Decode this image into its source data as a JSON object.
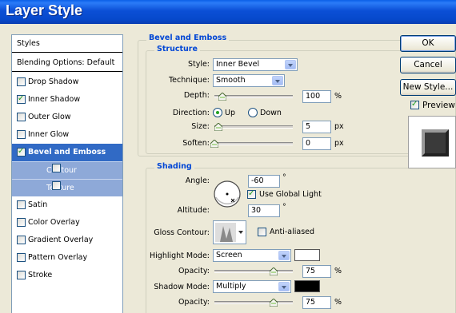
{
  "window": {
    "title": "Layer Style"
  },
  "styles_list": {
    "header": "Styles",
    "blending": "Blending Options: Default",
    "items": [
      {
        "label": "Drop Shadow",
        "checked": false,
        "kind": "row"
      },
      {
        "label": "Inner Shadow",
        "checked": true,
        "kind": "row"
      },
      {
        "label": "Outer Glow",
        "checked": false,
        "kind": "row"
      },
      {
        "label": "Inner Glow",
        "checked": false,
        "kind": "row"
      },
      {
        "label": "Bevel and Emboss",
        "checked": true,
        "kind": "selected"
      },
      {
        "label": "Contour",
        "checked": false,
        "kind": "sub"
      },
      {
        "label": "Texture",
        "checked": false,
        "kind": "sub"
      },
      {
        "label": "Satin",
        "checked": false,
        "kind": "row"
      },
      {
        "label": "Color Overlay",
        "checked": false,
        "kind": "row"
      },
      {
        "label": "Gradient Overlay",
        "checked": false,
        "kind": "row"
      },
      {
        "label": "Pattern Overlay",
        "checked": false,
        "kind": "row"
      },
      {
        "label": "Stroke",
        "checked": false,
        "kind": "row"
      }
    ]
  },
  "bevel": {
    "group_title": "Bevel and Emboss",
    "structure_title": "Structure",
    "style_label": "Style:",
    "style_value": "Inner Bevel",
    "technique_label": "Technique:",
    "technique_value": "Smooth",
    "depth_label": "Depth:",
    "depth_value": "100",
    "depth_unit": "%",
    "depth_level": 0.1,
    "direction_label": "Direction:",
    "direction_up": "Up",
    "direction_down": "Down",
    "direction_selected": "Up",
    "size_label": "Size:",
    "size_value": "5",
    "size_unit": "px",
    "size_level": 0.05,
    "soften_label": "Soften:",
    "soften_value": "0",
    "soften_unit": "px",
    "soften_level": 0.0
  },
  "shading": {
    "title": "Shading",
    "angle_label": "Angle:",
    "angle_value": "-60",
    "angle_unit": "°",
    "global_light_label": "Use Global Light",
    "global_light_checked": true,
    "altitude_label": "Altitude:",
    "altitude_value": "30",
    "altitude_unit": "°",
    "gloss_label": "Gloss Contour:",
    "antialiased_label": "Anti-aliased",
    "antialiased_checked": false,
    "highlight_mode_label": "Highlight Mode:",
    "highlight_mode_value": "Screen",
    "highlight_color": "#ffffff",
    "highlight_opacity_label": "Opacity:",
    "highlight_opacity_value": "75",
    "highlight_opacity_unit": "%",
    "highlight_opacity_level": 0.75,
    "shadow_mode_label": "Shadow Mode:",
    "shadow_mode_value": "Multiply",
    "shadow_color": "#000000",
    "shadow_opacity_label": "Opacity:",
    "shadow_opacity_value": "75",
    "shadow_opacity_unit": "%",
    "shadow_opacity_level": 0.75
  },
  "buttons": {
    "ok": "OK",
    "cancel": "Cancel",
    "new_style": "New Style...",
    "preview_label": "Preview",
    "preview_checked": true
  },
  "colors": {
    "accent": "#316ac5",
    "section_title": "#0046d5",
    "subitem_bg": "#8ea9d8"
  }
}
